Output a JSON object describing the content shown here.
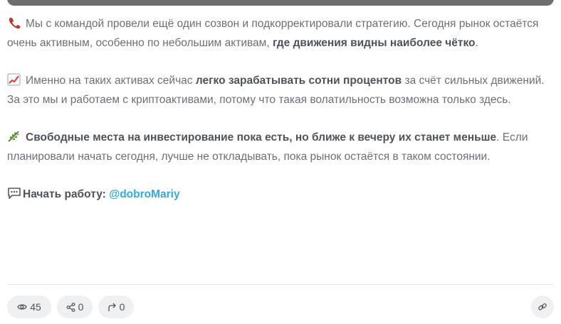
{
  "post": {
    "p1": {
      "text": "Мы с командой провели ещё один созвон и подкорректировали стратегию. Сегодня рынок остаётся очень активным, особенно по небольшим активам, ",
      "bold": "где движения видны наиболее чётко",
      "end": ".",
      "icon": "telephone-receiver-icon"
    },
    "p2": {
      "text": "Именно на таких активах сейчас ",
      "bold": "легко зарабатывать сотни процентов",
      "end": " за счёт сильных движений. За это мы и работаем с криптоактивами, потому что такая волатильность возможна только здесь.",
      "icon": "chart-increasing-icon"
    },
    "p3": {
      "bold": "Свободные места на инвестирование пока есть, но ближе к вечеру их станет меньше",
      "end": ". Если планировали начать сегодня, лучше не откладывать, пока рынок остаётся в таком состоянии.",
      "icon": "leaf-icon"
    },
    "cta": {
      "label": "Начать работу:",
      "link": "@dobroMariy",
      "icon": "speech-bubble-icon"
    }
  },
  "footer": {
    "views": "45",
    "shares": "0",
    "forwards": "0"
  },
  "colors": {
    "link": "#35a9d8",
    "text": "#6b6f76",
    "bold": "#4e535a",
    "chip": "#eef0f2"
  }
}
